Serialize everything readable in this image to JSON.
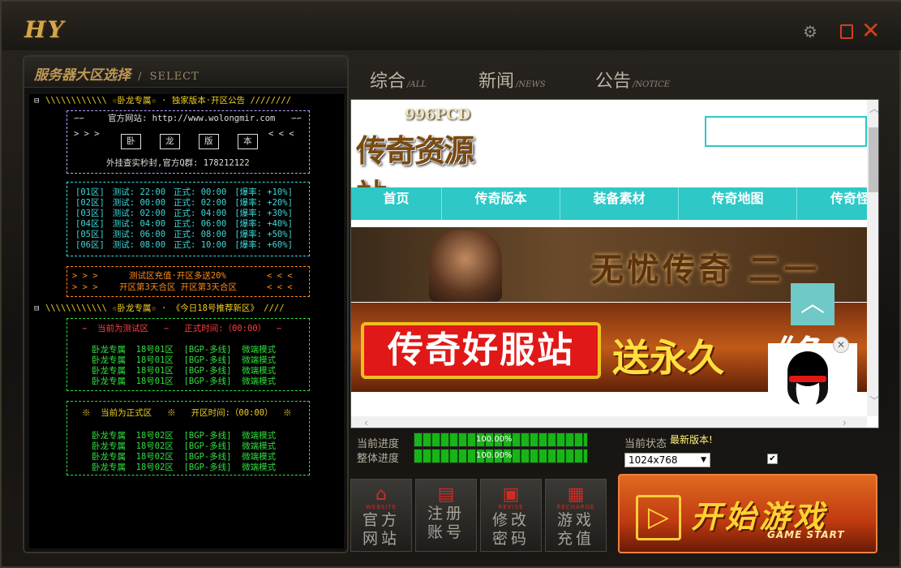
{
  "window": {
    "logo": "HY",
    "gear_icon": "gear-icon",
    "restore_icon": "restore-icon",
    "close_icon": "close-icon"
  },
  "left_panel": {
    "title": "服务器大区选择",
    "title_sep": "/",
    "subtitle": "SELECT"
  },
  "tree": {
    "group1_label": "☆卧龙专属☆ · 独家版本·开区公告",
    "box1": {
      "line1": "官方网站: http://www.wolongmir.com",
      "chars": [
        "卧",
        "龙",
        "版",
        "本"
      ],
      "line3": "外挂查实秒封,官方Q群: 178212122"
    },
    "schedule": [
      {
        "zone": "[01区]",
        "test": "测试: 22:00",
        "open": "正式: 00:00",
        "rate": "[爆率: +10%]"
      },
      {
        "zone": "[02区]",
        "test": "测试: 00:00",
        "open": "正式: 02:00",
        "rate": "[爆率: +20%]"
      },
      {
        "zone": "[03区]",
        "test": "测试: 02:00",
        "open": "正式: 04:00",
        "rate": "[爆率: +30%]"
      },
      {
        "zone": "[04区]",
        "test": "测试: 04:00",
        "open": "正式: 06:00",
        "rate": "[爆率: +40%]"
      },
      {
        "zone": "[05区]",
        "test": "测试: 06:00",
        "open": "正式: 08:00",
        "rate": "[爆率: +50%]"
      },
      {
        "zone": "[06区]",
        "test": "测试: 08:00",
        "open": "正式: 10:00",
        "rate": "[爆率: +60%]"
      }
    ],
    "box3": {
      "line1": "测试区充值·开区多送20%",
      "line2": "开区第3天合区 开区第3天合区"
    },
    "group2_label": "☆卧龙专属☆ · 《今日18号推荐新区》",
    "test_header": "当前为测试区   ∽   正式时间:（00:00）",
    "test_rows": [
      "卧龙专属  18号01区  [BGP-多线]  微端模式",
      "卧龙专属  18号01区  [BGP-多线]  微端模式",
      "卧龙专属  18号01区  [BGP-多线]  微端模式",
      "卧龙专属  18号01区  [BGP-多线]  微端模式"
    ],
    "open_header": "当前为正式区   ※   开区时间:（00:00）",
    "open_rows": [
      "卧龙专属  18号02区  [BGP-多线]  微端模式",
      "卧龙专属  18号02区  [BGP-多线]  微端模式",
      "卧龙专属  18号02区  [BGP-多线]  微端模式",
      "卧龙专属  18号02区  [BGP-多线]  微端模式"
    ]
  },
  "tabs": [
    {
      "label": "综合",
      "en": "ALL"
    },
    {
      "label": "新闻",
      "en": "NEWS"
    },
    {
      "label": "公告",
      "en": "NOTICE"
    }
  ],
  "site": {
    "logo_top": "996PCD",
    "logo_main": "传奇资源站",
    "nav": [
      "首页",
      "传奇版本",
      "装备素材",
      "传奇地图",
      "传奇怪"
    ],
    "banner1_text": "无忧传奇 二一",
    "banner2_red": "传奇好服站",
    "banner2_text": "送永久",
    "banner2_text2": "《魚",
    "totop_icon": "chevron-up-icon"
  },
  "progress": {
    "current_label": "当前进度",
    "total_label": "整体进度",
    "current_value": "100.00%",
    "total_value": "100.00%",
    "current_fraction": 1.0,
    "total_fraction": 1.0
  },
  "status": {
    "label": "当前状态",
    "value": "最新版本!",
    "resolution": "1024x768",
    "checked": true
  },
  "buttons": [
    {
      "icon": "home-icon",
      "en": "WEBSITE",
      "zh1": "官方",
      "zh2": "网站"
    },
    {
      "icon": "register-icon",
      "en": "",
      "zh1": "注册",
      "zh2": "账号"
    },
    {
      "icon": "lock-icon",
      "en": "REVISE",
      "zh1": "修改",
      "zh2": "密码"
    },
    {
      "icon": "recharge-icon",
      "en": "RECHARGE",
      "zh1": "游戏",
      "zh2": "充值"
    }
  ],
  "start": {
    "zh": "开始游戏",
    "en": "GAME START"
  }
}
